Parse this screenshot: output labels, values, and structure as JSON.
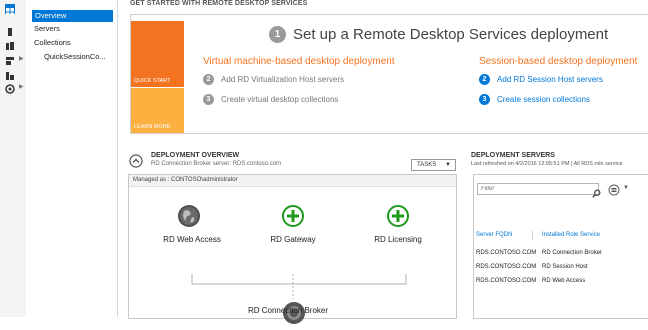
{
  "nav": {
    "items": [
      {
        "label": "Overview",
        "selected": true
      },
      {
        "label": "Servers"
      },
      {
        "label": "Collections"
      },
      {
        "label": "QuickSessionCo..."
      }
    ]
  },
  "get_started": {
    "title": "GET STARTED WITH REMOTE DESKTOP SERVICES",
    "quick_start": "QUICK START",
    "learn_more": "LEARN MORE",
    "step1_number": "1",
    "step1_text": "Set up a Remote Desktop Services deployment",
    "vm_heading": "Virtual machine-based desktop deployment",
    "vm_steps": [
      {
        "number": "2",
        "text": "Add RD Virtualization Host servers"
      },
      {
        "number": "3",
        "text": "Create virtual desktop collections"
      }
    ],
    "session_heading": "Session-based desktop deployment",
    "session_steps": [
      {
        "number": "2",
        "text": "Add RD Session Host servers"
      },
      {
        "number": "3",
        "text": "Create session collections"
      }
    ]
  },
  "deployment_overview": {
    "title": "DEPLOYMENT OVERVIEW",
    "subtitle": "RD Connection Broker server: RDS.contoso.com",
    "tasks_label": "TASKS",
    "managed_as": "Managed as : CONTOSO\\administrator",
    "roles": {
      "web_access": "RD Web Access",
      "gateway": "RD Gateway",
      "licensing": "RD Licensing",
      "connection_broker": "RD Connection Broker"
    }
  },
  "deployment_servers": {
    "title": "DEPLOYMENT SERVERS",
    "subtitle": "Last refreshed on 4/2/2016 12:05:51 PM | All RDS role service",
    "filter_placeholder": "Filter",
    "columns": [
      "Server FQDN",
      "Installed Role Service"
    ],
    "rows": [
      [
        "RDS.CONTOSO.COM",
        "RD Connection Broker"
      ],
      [
        "RDS.CONTOSO.COM",
        "RD Session Host"
      ],
      [
        "RDS.CONTOSO.COM",
        "RD Web Access"
      ]
    ]
  },
  "colors": {
    "accent_blue": "#0078d7",
    "orange": "#f37320",
    "light_orange": "#fbb040",
    "green": "#1e9a1e"
  }
}
